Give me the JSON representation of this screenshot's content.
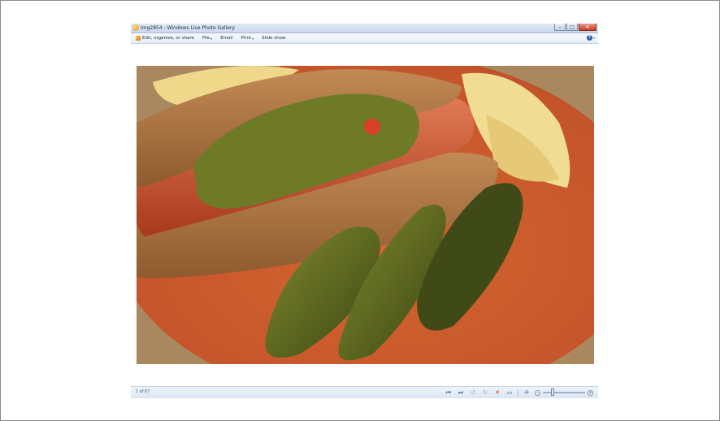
{
  "window": {
    "title": "Img2854 - Windows Live Photo Gallery",
    "icon": "photo-gallery-icon",
    "controls": {
      "minimize": "–",
      "maximize": "□",
      "close": "✕"
    }
  },
  "menubar": {
    "items": [
      {
        "label": "Edit, organize, or share",
        "icon": "edit-organize-icon",
        "has_caret": false
      },
      {
        "label": "File",
        "has_caret": true
      },
      {
        "label": "Email",
        "has_caret": false
      },
      {
        "label": "Print",
        "has_caret": true
      },
      {
        "label": "Slide show",
        "has_caret": false
      }
    ],
    "help_glyph": "?",
    "caret_glyph": "▾"
  },
  "photo": {
    "colors": {
      "plate": "#c8592a",
      "bun": "#a9713f",
      "sausage": "#c24a2a",
      "relish": "#6f7a26",
      "pickle": "#4f5a1c",
      "chips": "#f0d98c",
      "table": "#a9875f"
    }
  },
  "navbar": {
    "counter": "1 of 67",
    "zoom_level": 0.2,
    "controls": [
      {
        "name": "previous-button",
        "glyph": "⏮",
        "style": "blue"
      },
      {
        "name": "next-button",
        "glyph": "⏭",
        "style": "blue"
      },
      {
        "name": "rotate-left-button",
        "glyph": "↺",
        "style": "grey"
      },
      {
        "name": "rotate-right-button",
        "glyph": "↻",
        "style": "grey"
      },
      {
        "name": "delete-button",
        "glyph": "✕",
        "style": "red"
      },
      {
        "name": "slideshow-button",
        "glyph": "▭",
        "style": "blue"
      }
    ],
    "fit_glyph": "✢",
    "zoom_minus": "−",
    "zoom_plus": "+"
  }
}
